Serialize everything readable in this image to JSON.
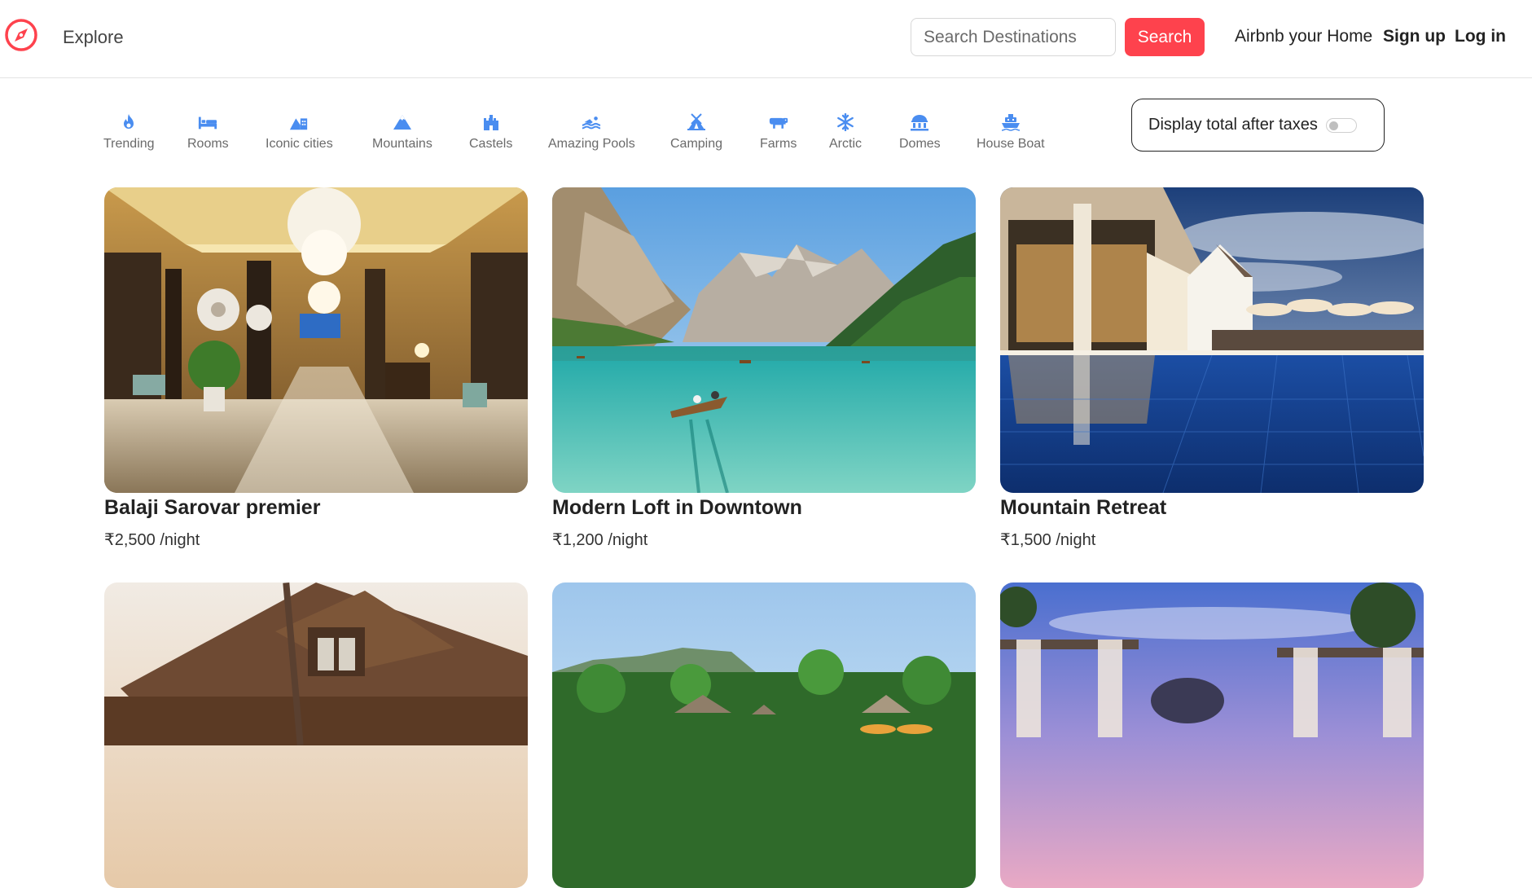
{
  "navbar": {
    "explore": "Explore",
    "search_placeholder": "Search Destinations",
    "search_button": "Search",
    "host_link": "Airbnb your Home",
    "signup": "Sign up",
    "login": "Log in",
    "brand_color": "#fe424d",
    "logo_icon": "compass-icon"
  },
  "filters": [
    {
      "label": "Trending",
      "icon": "fire-icon"
    },
    {
      "label": "Rooms",
      "icon": "bed-icon"
    },
    {
      "label": "Iconic cities",
      "icon": "mountain-city-icon"
    },
    {
      "label": "Mountains",
      "icon": "mountain-icon"
    },
    {
      "label": "Castels",
      "icon": "castle-icon"
    },
    {
      "label": "Amazing Pools",
      "icon": "person-swimming-icon"
    },
    {
      "label": "Camping",
      "icon": "campground-icon"
    },
    {
      "label": "Farms",
      "icon": "cow-icon"
    },
    {
      "label": "Arctic",
      "icon": "snowflake-icon"
    },
    {
      "label": "Domes",
      "icon": "dome-building-icon"
    },
    {
      "label": "House Boat",
      "icon": "ship-icon"
    }
  ],
  "filter_icon_color": "#4a8df0",
  "tax_toggle": {
    "label": "Display total after taxes",
    "on": false
  },
  "listings": [
    {
      "title": "Balaji Sarovar premier",
      "price": "₹2,500 /night",
      "image": "hotel-lobby-image"
    },
    {
      "title": "Modern Loft in Downtown",
      "price": "₹1,200 /night",
      "image": "mountain-lake-image"
    },
    {
      "title": "Mountain Retreat",
      "price": "₹1,500 /night",
      "image": "resort-pool-image"
    },
    {
      "title": "",
      "price": "",
      "image": "wooden-lodge-image"
    },
    {
      "title": "",
      "price": "",
      "image": "tropical-resort-image"
    },
    {
      "title": "",
      "price": "",
      "image": "sunset-cabana-image"
    }
  ]
}
